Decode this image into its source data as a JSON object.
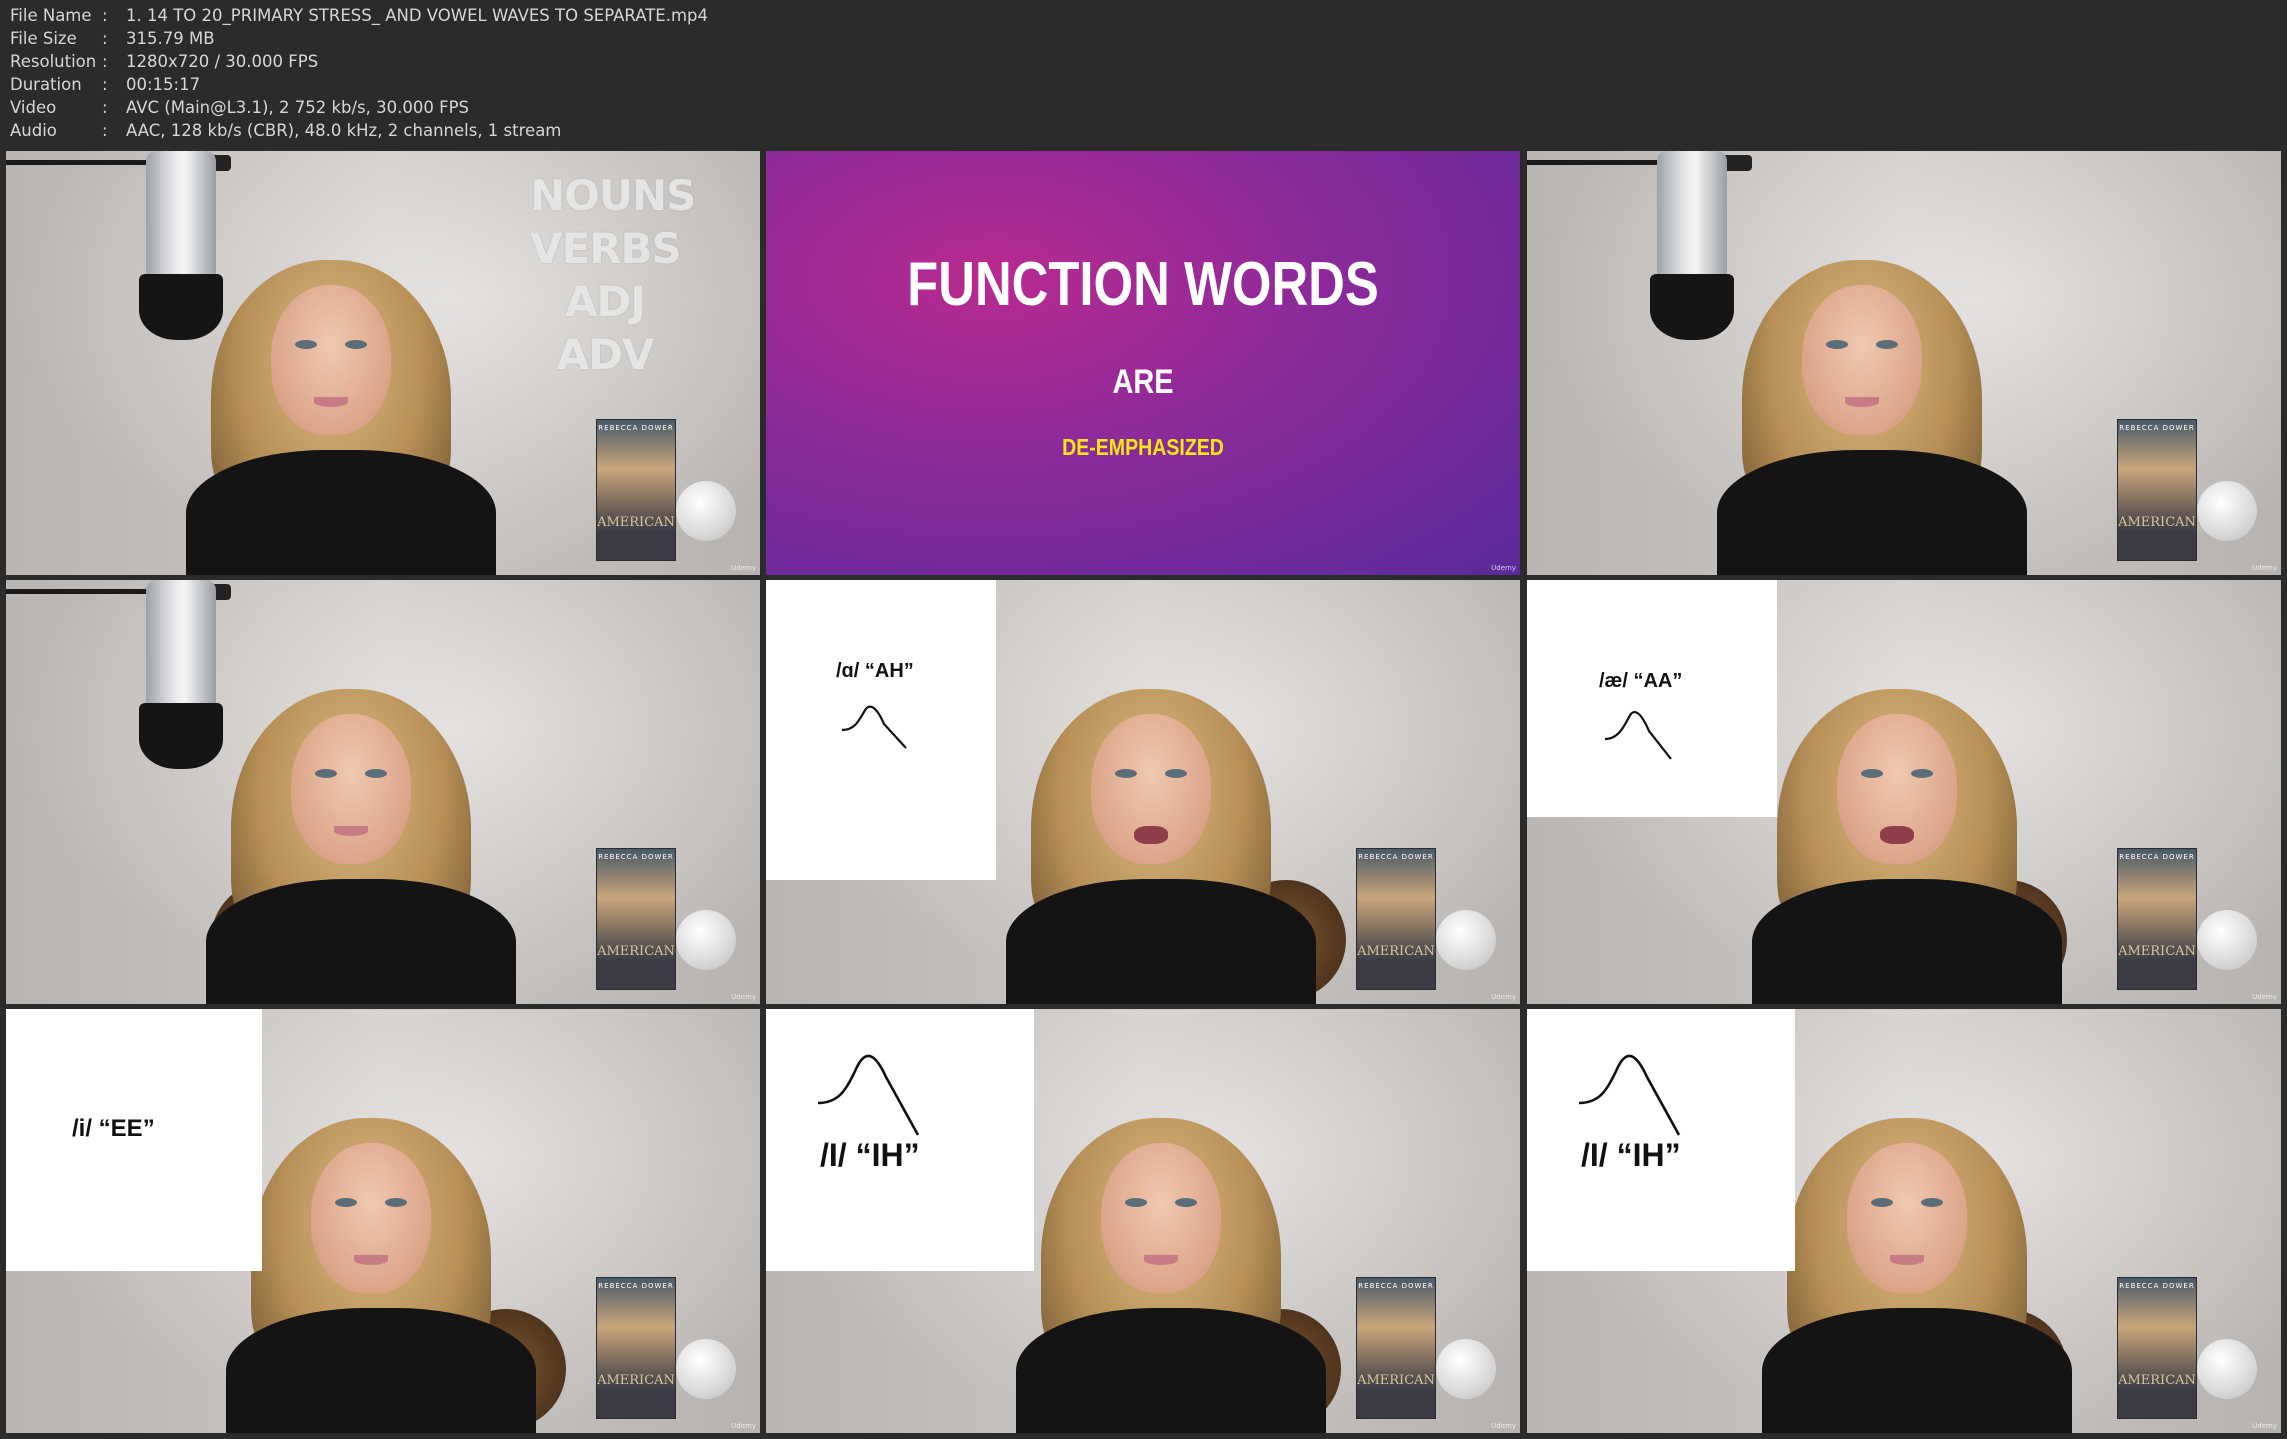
{
  "meta": [
    {
      "key": "File Name",
      "sep": ":",
      "value": "1. 14 TO 20_PRIMARY STRESS_ AND VOWEL WAVES TO SEPARATE.mp4"
    },
    {
      "key": "File Size",
      "sep": ":",
      "value": "315.79 MB"
    },
    {
      "key": "Resolution",
      "sep": ":",
      "value": "1280x720 / 30.000 FPS"
    },
    {
      "key": "Duration",
      "sep": ":",
      "value": "00:15:17"
    },
    {
      "key": "Video",
      "sep": ":",
      "value": "AVC (Main@L3.1), 2 752 kb/s, 30.000 FPS"
    },
    {
      "key": "Audio",
      "sep": ":",
      "value": "AAC, 128 kb/s (CBR), 48.0 kHz, 2 channels, 1 stream"
    }
  ],
  "frames": {
    "f1": {
      "words": [
        "NOUNS",
        "VERBS",
        "ADJ",
        "ADV"
      ],
      "udemy": "Udemy"
    },
    "f2": {
      "title": "FUNCTION WORDS",
      "are": "ARE",
      "de": "DE-EMPHASIZED",
      "udemy": "Udemy"
    },
    "f3": {
      "udemy": "Udemy"
    },
    "f4": {
      "udemy": "Udemy"
    },
    "f5": {
      "label": "/ɑ/ “AH”",
      "udemy": "Udemy"
    },
    "f6": {
      "label": "/æ/ “AA”",
      "udemy": "Udemy"
    },
    "f7": {
      "label": "/i/ “EE”",
      "udemy": "Udemy"
    },
    "f8": {
      "label": "/I/ “IH”",
      "udemy": "Udemy"
    },
    "f9": {
      "label": "/I/ “IH”",
      "udemy": "Udemy"
    }
  },
  "book": {
    "author": "REBECCA DOWER",
    "title": "AMERICAN"
  },
  "colors": {
    "background": "#2b2b2b",
    "meta_text": "#d6d6d6",
    "slide_yellow": "#f6e716",
    "slide_purple": "#8f2a9a"
  }
}
